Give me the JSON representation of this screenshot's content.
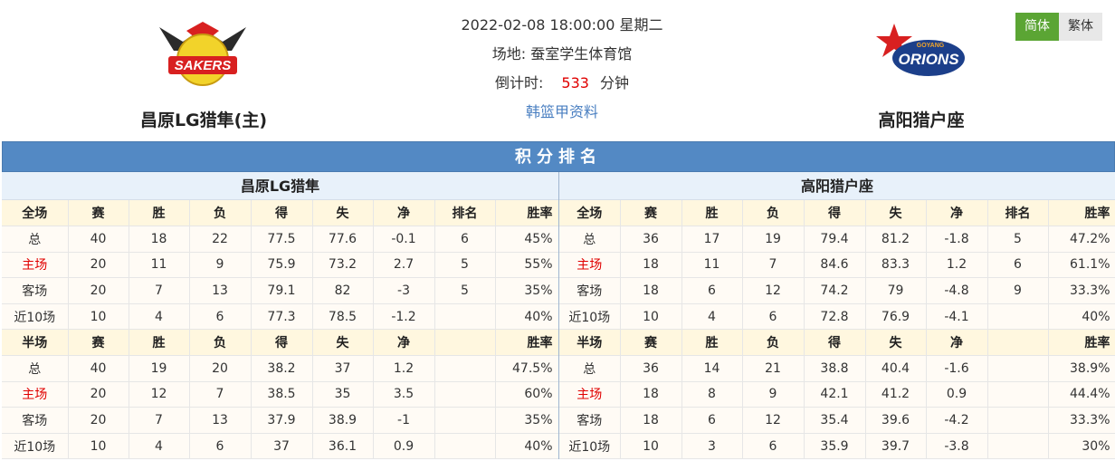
{
  "match": {
    "datetime": "2022-02-08 18:00:00 星期二",
    "venue_label": "场地:",
    "venue": "蚕室学生体育馆",
    "countdown_label": "倒计时:",
    "countdown_value": "533",
    "countdown_unit": "分钟",
    "league_link": "韩篮甲资料"
  },
  "lang": {
    "simplified": "简体",
    "traditional": "繁体"
  },
  "home_team": {
    "name": "昌原LG猎隼(主)",
    "logo_text": "SAKERS",
    "table_title": "昌原LG猎隼"
  },
  "away_team": {
    "name": "高阳猎户座",
    "logo_text": "ORIONS",
    "logo_small": "GOYANG",
    "table_title": "高阳猎户座"
  },
  "standings_title": "积分排名",
  "colors": {
    "header_blue": "#5389c4",
    "home_red": "#e00000",
    "lang_green": "#5ba534"
  },
  "tables": {
    "home": {
      "full_header": [
        "全场",
        "赛",
        "胜",
        "负",
        "得",
        "失",
        "净",
        "排名",
        "胜率"
      ],
      "full_rows": [
        [
          "总",
          "40",
          "18",
          "22",
          "77.5",
          "77.6",
          "-0.1",
          "6",
          "45%"
        ],
        [
          "主场",
          "20",
          "11",
          "9",
          "75.9",
          "73.2",
          "2.7",
          "5",
          "55%"
        ],
        [
          "客场",
          "20",
          "7",
          "13",
          "79.1",
          "82",
          "-3",
          "5",
          "35%"
        ],
        [
          "近10场",
          "10",
          "4",
          "6",
          "77.3",
          "78.5",
          "-1.2",
          "",
          "40%"
        ]
      ],
      "half_header": [
        "半场",
        "赛",
        "胜",
        "负",
        "得",
        "失",
        "净",
        "",
        "胜率"
      ],
      "half_rows": [
        [
          "总",
          "40",
          "19",
          "20",
          "38.2",
          "37",
          "1.2",
          "",
          "47.5%"
        ],
        [
          "主场",
          "20",
          "12",
          "7",
          "38.5",
          "35",
          "3.5",
          "",
          "60%"
        ],
        [
          "客场",
          "20",
          "7",
          "13",
          "37.9",
          "38.9",
          "-1",
          "",
          "35%"
        ],
        [
          "近10场",
          "10",
          "4",
          "6",
          "37",
          "36.1",
          "0.9",
          "",
          "40%"
        ]
      ]
    },
    "away": {
      "full_header": [
        "全场",
        "赛",
        "胜",
        "负",
        "得",
        "失",
        "净",
        "排名",
        "胜率"
      ],
      "full_rows": [
        [
          "总",
          "36",
          "17",
          "19",
          "79.4",
          "81.2",
          "-1.8",
          "5",
          "47.2%"
        ],
        [
          "主场",
          "18",
          "11",
          "7",
          "84.6",
          "83.3",
          "1.2",
          "6",
          "61.1%"
        ],
        [
          "客场",
          "18",
          "6",
          "12",
          "74.2",
          "79",
          "-4.8",
          "9",
          "33.3%"
        ],
        [
          "近10场",
          "10",
          "4",
          "6",
          "72.8",
          "76.9",
          "-4.1",
          "",
          "40%"
        ]
      ],
      "half_header": [
        "半场",
        "赛",
        "胜",
        "负",
        "得",
        "失",
        "净",
        "",
        "胜率"
      ],
      "half_rows": [
        [
          "总",
          "36",
          "14",
          "21",
          "38.8",
          "40.4",
          "-1.6",
          "",
          "38.9%"
        ],
        [
          "主场",
          "18",
          "8",
          "9",
          "42.1",
          "41.2",
          "0.9",
          "",
          "44.4%"
        ],
        [
          "客场",
          "18",
          "6",
          "12",
          "35.4",
          "39.6",
          "-4.2",
          "",
          "33.3%"
        ],
        [
          "近10场",
          "10",
          "3",
          "6",
          "35.9",
          "39.7",
          "-3.8",
          "",
          "30%"
        ]
      ]
    }
  }
}
